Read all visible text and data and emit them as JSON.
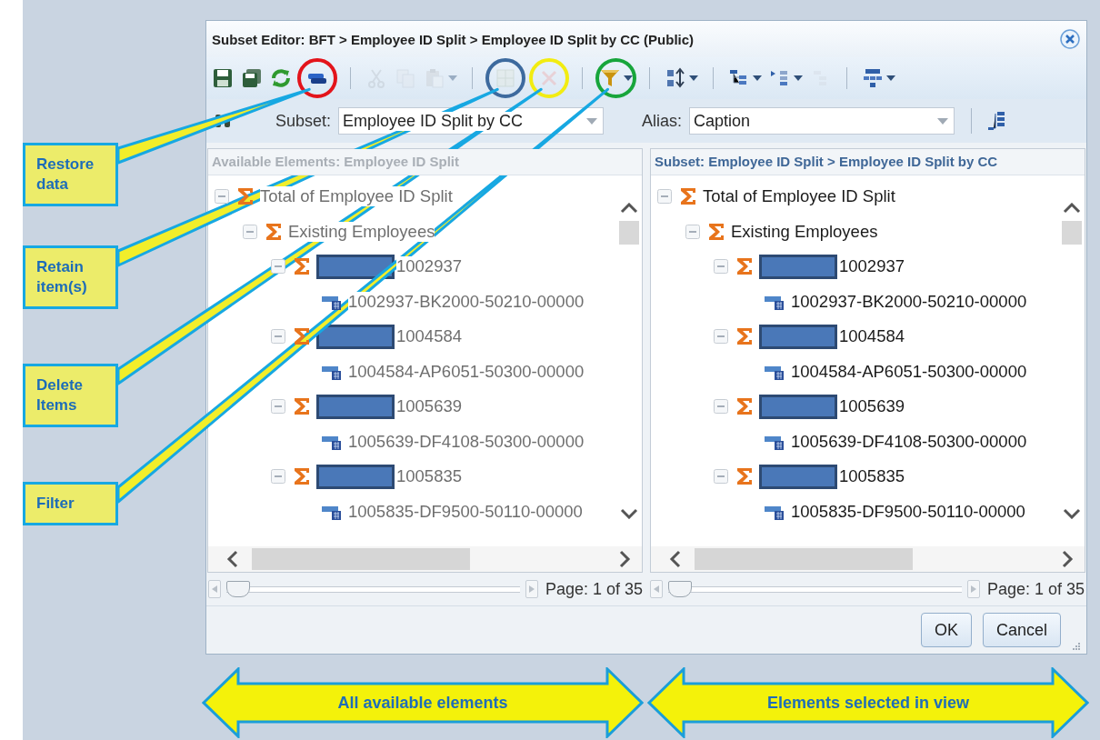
{
  "window": {
    "title": "Subset Editor: BFT > Employee ID Split > Employee ID Split by CC (Public)"
  },
  "toolbar": [
    {
      "kind": "tool",
      "disabled": false,
      "dropdown": false
    },
    {
      "kind": "tool",
      "disabled": false,
      "dropdown": false
    },
    {
      "kind": "tool",
      "disabled": false,
      "dropdown": false
    },
    {
      "kind": "tool",
      "disabled": false,
      "dropdown": false,
      "color": "#e3141b"
    },
    {
      "kind": "separator"
    },
    {
      "kind": "tool",
      "disabled": true,
      "dropdown": false
    },
    {
      "kind": "tool",
      "disabled": true,
      "dropdown": false
    },
    {
      "kind": "tool",
      "disabled": true,
      "dropdown": true
    },
    {
      "kind": "separator"
    },
    {
      "kind": "tool",
      "disabled": true,
      "dropdown": false,
      "color": "#3d6a9e"
    },
    {
      "kind": "tool",
      "disabled": true,
      "dropdown": false,
      "color": "#f2ec12"
    },
    {
      "kind": "separator"
    },
    {
      "kind": "tool",
      "disabled": false,
      "dropdown": true,
      "color": "#17a53b"
    },
    {
      "kind": "separator"
    },
    {
      "kind": "tool",
      "disabled": false,
      "dropdown": true
    },
    {
      "kind": "separator"
    },
    {
      "kind": "tool",
      "disabled": false,
      "dropdown": true
    },
    {
      "kind": "tool",
      "disabled": false,
      "dropdown": true
    },
    {
      "kind": "tool",
      "disabled": true,
      "dropdown": false
    },
    {
      "kind": "separator"
    },
    {
      "kind": "tool",
      "disabled": false,
      "dropdown": true
    }
  ],
  "subset_bar": {
    "subset_label": "Subset:",
    "subset_value": "Employee ID Split by CC",
    "alias_label": "Alias:",
    "alias_value": "Caption"
  },
  "panels": [
    {
      "header": "Available Elements: Employee ID Split",
      "dimmed": true,
      "pager": {
        "level": 0,
        "page": "Page: 1 of 35"
      },
      "tree": [
        {
          "kind": "sigma",
          "label": "Total of Employee ID Split",
          "expanded": true,
          "children": [
            {
              "kind": "sigma",
              "label": "Existing Employees",
              "expanded": true,
              "children": [
                {
                  "kind": "sigma",
                  "label": "1002937",
                  "redacted": true,
                  "expanded": true,
                  "children": [
                    {
                      "kind": "leaf",
                      "label": "1002937-BK2000-50210-00000"
                    }
                  ]
                },
                {
                  "kind": "sigma",
                  "label": "1004584",
                  "redacted": true,
                  "expanded": true,
                  "children": [
                    {
                      "kind": "leaf",
                      "label": "1004584-AP6051-50300-00000"
                    }
                  ]
                },
                {
                  "kind": "sigma",
                  "label": "1005639",
                  "redacted": true,
                  "expanded": true,
                  "children": [
                    {
                      "kind": "leaf",
                      "label": "1005639-DF4108-50300-00000"
                    }
                  ]
                },
                {
                  "kind": "sigma",
                  "label": "1005835",
                  "redacted": true,
                  "expanded": true,
                  "children": [
                    {
                      "kind": "leaf",
                      "label": "1005835-DF9500-50110-00000"
                    }
                  ]
                }
              ]
            }
          ]
        }
      ]
    },
    {
      "header": "Subset: Employee ID Split > Employee ID Split by CC",
      "dimmed": false,
      "pager": {
        "level": 0,
        "page": "Page: 1 of 35"
      },
      "tree": [
        {
          "kind": "sigma",
          "label": "Total of Employee ID Split",
          "expanded": true,
          "children": [
            {
              "kind": "sigma",
              "label": "Existing Employees",
              "expanded": true,
              "children": [
                {
                  "kind": "sigma",
                  "label": "1002937",
                  "redacted": true,
                  "expanded": true,
                  "children": [
                    {
                      "kind": "leaf",
                      "label": "1002937-BK2000-50210-00000"
                    }
                  ]
                },
                {
                  "kind": "sigma",
                  "label": "1004584",
                  "redacted": true,
                  "expanded": true,
                  "children": [
                    {
                      "kind": "leaf",
                      "label": "1004584-AP6051-50300-00000"
                    }
                  ]
                },
                {
                  "kind": "sigma",
                  "label": "1005639",
                  "redacted": true,
                  "expanded": true,
                  "children": [
                    {
                      "kind": "leaf",
                      "label": "1005639-DF4108-50300-00000"
                    }
                  ]
                },
                {
                  "kind": "sigma",
                  "label": "1005835",
                  "redacted": true,
                  "expanded": true,
                  "children": [
                    {
                      "kind": "leaf",
                      "label": "1005835-DF9500-50110-00000"
                    }
                  ]
                }
              ]
            }
          ]
        }
      ]
    }
  ],
  "buttons": [
    "OK",
    "Cancel"
  ],
  "callouts": [
    "Restore data",
    "Retain item(s)",
    "Delete Items",
    "Filter"
  ],
  "arrows": [
    "All available elements",
    "Elements selected in view"
  ]
}
